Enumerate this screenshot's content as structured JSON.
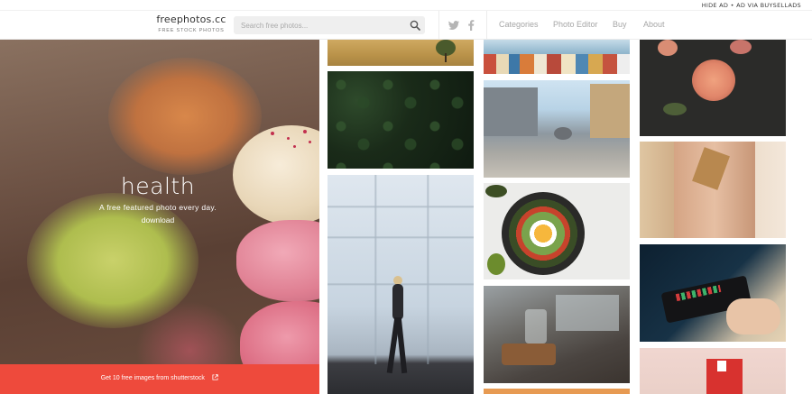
{
  "adbar": {
    "text": "HIDE AD • AD VIA BUYSELLADS"
  },
  "header": {
    "logo_name": "freephotos.cc",
    "logo_tag": "FREE STOCK PHOTOS",
    "search_placeholder": "Search free photos...",
    "icons": {
      "search": "search-icon",
      "twitter": "twitter-icon",
      "facebook": "facebook-icon"
    },
    "nav": [
      {
        "label": "Categories"
      },
      {
        "label": "Photo Editor"
      },
      {
        "label": "Buy"
      },
      {
        "label": "About"
      }
    ]
  },
  "hero": {
    "title": "health",
    "subtitle": "A free featured photo every day.",
    "download_label": "download",
    "promo_text": "Get 10 free images from shutterstock",
    "promo_icon": "external-link-icon",
    "promo_color": "#ee4a3c"
  },
  "photos": [
    {
      "name": "photo-field-tree"
    },
    {
      "name": "photo-green-leaves"
    },
    {
      "name": "photo-woman-marble-wall"
    },
    {
      "name": "photo-colorful-town"
    },
    {
      "name": "photo-pigeon-street"
    },
    {
      "name": "photo-food-bowl"
    },
    {
      "name": "photo-kitchen-cookies"
    },
    {
      "name": "photo-orange-partial"
    },
    {
      "name": "photo-flowers-dark"
    },
    {
      "name": "photo-woman-coat"
    },
    {
      "name": "photo-card-payment"
    },
    {
      "name": "photo-red-house"
    }
  ]
}
